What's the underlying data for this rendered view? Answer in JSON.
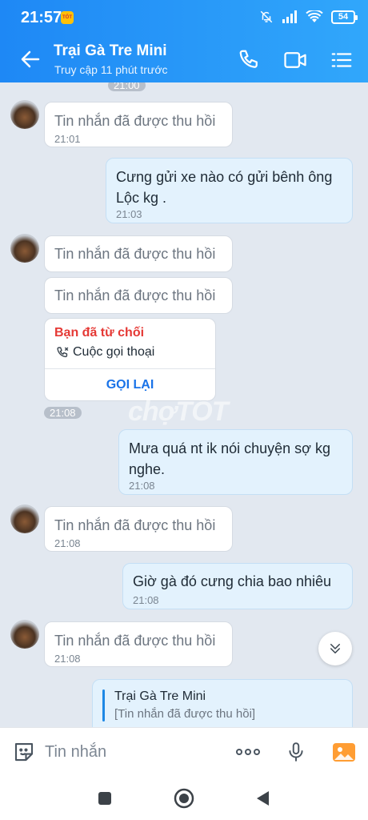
{
  "status_bar": {
    "time": "21:57",
    "badge": "TỐT",
    "battery": "54"
  },
  "header": {
    "contact_name": "Trại Gà Tre Mini",
    "contact_status": "Truy cập 11 phút trước",
    "icons": [
      "back-arrow-icon",
      "phone-icon",
      "video-call-icon",
      "menu-list-icon"
    ]
  },
  "chat": {
    "time_pill_top": "21:00",
    "time_pill_call": "21:08",
    "messages": [
      {
        "from": "them",
        "text": "Tin nhắn đã được thu hồi",
        "time": "21:01"
      },
      {
        "from": "me",
        "text": "Cưng gửi xe nào có gửi bênh ông Lộc kg .",
        "time": "21:03"
      },
      {
        "from": "them",
        "text": "Tin nhắn đã được thu hồi",
        "time": ""
      },
      {
        "from": "them",
        "text": "Tin nhắn đã được thu hồi",
        "time": ""
      },
      {
        "from": "me",
        "text": "Mưa quá nt ik nói chuyện sợ kg nghe.",
        "time": "21:08"
      },
      {
        "from": "them",
        "text": "Tin nhắn đã được thu hồi",
        "time": "21:08"
      },
      {
        "from": "me",
        "text": "Giờ gà đó cưng chia bao nhiêu",
        "time": "21:08"
      },
      {
        "from": "them",
        "text": "Tin nhắn đã được thu hồi",
        "time": "21:08"
      }
    ],
    "call_card": {
      "title": "Bạn đã từ chối",
      "subtitle": "Cuộc gọi thoại",
      "action": "GỌI LẠI"
    },
    "quote": {
      "name": "Trại Gà Tre Mini",
      "text": "[Tin nhắn đã được thu hồi]"
    },
    "watermark": "chợTỐT"
  },
  "input_bar": {
    "placeholder": "Tin nhắn"
  },
  "colors": {
    "header_start": "#1e88f5",
    "header_end": "#31a7fb",
    "my_bubble": "#e3f2fd",
    "declined_red": "#e53935",
    "call_back_blue": "#1a73e8"
  }
}
